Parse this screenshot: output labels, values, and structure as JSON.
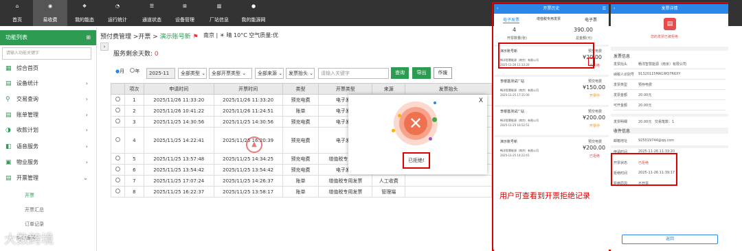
{
  "nav": [
    "首页",
    "易收费",
    "我的能态",
    "运行统计",
    "通道状态",
    "设备管理",
    "厂站信息",
    "我的能源网"
  ],
  "sidebar": {
    "title": "功能列表",
    "search_placeholder": "请输入功能关键字",
    "items": [
      "综合首页",
      "设备统计",
      "交易查询",
      "账单管理",
      "收款计划",
      "语音服务",
      "物业服务",
      "开票管理"
    ],
    "subitems": [
      "开票",
      "开票汇总",
      "订单记录",
      "统计报表"
    ]
  },
  "breadcrumb": {
    "prefix": "预付费管理 >开票 > ",
    "current": "演示账号新",
    "location": "南京",
    "weather": "晴 10°C 空气质量:优"
  },
  "remain": {
    "label": "服务剩余天数:",
    "value": "0"
  },
  "filters": {
    "month": "月",
    "year": "年",
    "date": "2025-11",
    "type": "全部类型",
    "ticket_type": "全部开票类型",
    "source": "全部来源",
    "head": "发票抬头",
    "keyword_placeholder": "请输入关键字",
    "query": "查询",
    "export": "导出",
    "cancel": "作废"
  },
  "table": {
    "headers": [
      "",
      "项次",
      "申请时间",
      "开票时间",
      "类型",
      "开票类型",
      "来源",
      "发票抬头"
    ],
    "rows": [
      [
        "",
        "1",
        "2025/11/26 11:33:20",
        "2025/11/26 11:33:20",
        "预充电费",
        "电子发票",
        "",
        ""
      ],
      [
        "",
        "2",
        "2025/11/26 10:41:22",
        "2025/11/26 11:24:51",
        "账单",
        "电子发票",
        "",
        ""
      ],
      [
        "",
        "3",
        "2025/11/25 14:30:56",
        "2025/11/25 14:30:56",
        "预充电费",
        "电子发票",
        "",
        ""
      ],
      [
        "",
        "4",
        "2025/11/25 14:22:41",
        "2025/11/25 16:20:39",
        "预充电费",
        "电子发票",
        "",
        ""
      ],
      [
        "",
        "5",
        "2025/11/25 13:57:48",
        "2025/11/25 14:34:25",
        "预充电费",
        "增值税专用发票",
        "",
        ""
      ],
      [
        "",
        "6",
        "2025/11/25 13:54:42",
        "2025/11/25 13:54:42",
        "预充电费",
        "电子发票",
        "",
        "畅洋智慧能源（南京）有限公司"
      ],
      [
        "",
        "7",
        "2025/11/25 17:07:24",
        "2025/11/25 14:26:37",
        "账单",
        "增值税专用发票",
        "人工收费",
        ""
      ],
      [
        "",
        "8",
        "2025/11/25 16:22:37",
        "2025/11/25 13:58:17",
        "账单",
        "增值税专用发票",
        "管理端",
        ""
      ]
    ]
  },
  "modal": {
    "close": "X",
    "message": "已拒绝!"
  },
  "phone1": {
    "title": "开票历史",
    "tabs": [
      "电子发票",
      "增值税专用发票",
      "电子票"
    ],
    "count": "4",
    "count_label": "开票数量(张)",
    "amount": "390.00",
    "amount_label": "总金额(元)",
    "cards": [
      {
        "name": "演示账号新",
        "right": "预交电费",
        "company": "畅洋智慧能源（南京）有限公司",
        "time": "2025-11-26 11:33:20",
        "amount": "¥20.00",
        "status": "已拒绝"
      },
      {
        "name": "李楼基测试厂站",
        "right": "预交电费",
        "company": "畅洋智慧能源（南京）有限公司",
        "time": "2025-11-25 17:11:00",
        "amount": "¥150.00",
        "status": "开票中"
      },
      {
        "name": "李楼基测试厂站",
        "right": "预交电费",
        "company": "畅洋智慧能源（南京）有限公司",
        "time": "2025-11-25 16:52:51",
        "amount": "¥200.00",
        "status": "开票中"
      },
      {
        "name": "演示账号新",
        "right": "预交电费",
        "company": "畅洋智慧能源（南京）有限公司",
        "time": "2025-11-25 14:22:41",
        "amount": "¥200.00",
        "status": "已拒绝"
      }
    ]
  },
  "phone2": {
    "title": "发票详情",
    "banner": "您的发票已被拒绝",
    "section1": "发票信息",
    "rows1": [
      [
        "发票抬头",
        "畅洋智慧能源（南京）有限公司"
      ],
      [
        "纳税人识别号",
        "91320115MA1WQ7R6XY"
      ],
      [
        "发票类型",
        "预存电费"
      ],
      [
        "发票金额",
        "20.00元"
      ],
      [
        "可开金额",
        "20.00元"
      ]
    ],
    "amount_row": [
      "发票明细",
      "20.00元",
      "交易笔数：1"
    ],
    "section2": "收件信息",
    "email": [
      "邮箱地址",
      "925019744@qq.com"
    ],
    "apply": [
      "申请时间",
      "2025-11-26 11:33:20"
    ],
    "rows3": [
      [
        "开票状态",
        "已拒绝"
      ],
      [
        "拒绝时间",
        "2025-11-26 11:39:17"
      ],
      [
        "拒绝原因",
        "不开票"
      ]
    ],
    "return": "返回"
  },
  "caption": "用户可查看到开票拒绝记录",
  "watermark": "大数跨境",
  "colors": {
    "green": "#2d9b52",
    "blue": "#2a86e8",
    "red": "#d00"
  }
}
